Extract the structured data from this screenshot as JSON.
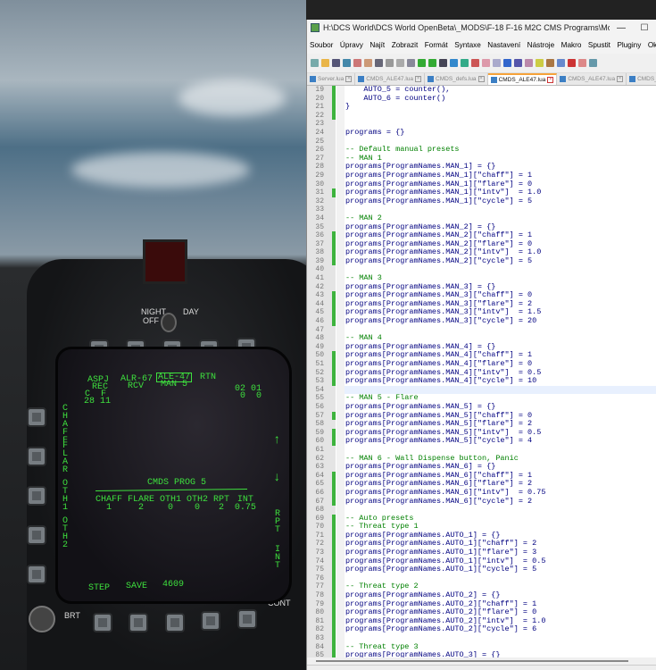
{
  "window": {
    "title": "H:\\DCS World\\DCS World OpenBeta\\_MODS\\F-18 F-16  M2C CMS Programs\\Mods\\aircraft\\FA...",
    "minimize": "—",
    "maximize": "☐"
  },
  "menu": [
    "Soubor",
    "Úpravy",
    "Najít",
    "Zobrazit",
    "Formát",
    "Syntaxe",
    "Nastavení",
    "Nástroje",
    "Makro",
    "Spustit",
    "Pluginy",
    "Okna",
    "?"
  ],
  "tabs": [
    {
      "label": "Server.lua"
    },
    {
      "label": "CMDS_ALE47.lua"
    },
    {
      "label": "CMDS_defs.lua"
    },
    {
      "label": "CMDS_ALE47.lua",
      "active": true
    },
    {
      "label": "CMDS_ALE47.lua"
    },
    {
      "label": "CMDS_defs.lua"
    }
  ],
  "editor": {
    "first_line": 19,
    "current_line": 54,
    "changed_lines": [
      19,
      20,
      21,
      22,
      31,
      36,
      37,
      38,
      39,
      43,
      44,
      45,
      46,
      50,
      51,
      52,
      53,
      57,
      59,
      60,
      64,
      65,
      66,
      67,
      69,
      70,
      71,
      72,
      73,
      74,
      75,
      76,
      77,
      78,
      79,
      80,
      81,
      82,
      83,
      84,
      85
    ],
    "lines": [
      "    AUTO_5 = counter(),",
      "    AUTO_6 = counter()",
      "}",
      "",
      "",
      "programs = {}",
      "",
      "-- Default manual presets",
      "-- MAN 1",
      "programs[ProgramNames.MAN_1] = {}",
      "programs[ProgramNames.MAN_1][\"chaff\"] = 1",
      "programs[ProgramNames.MAN_1][\"flare\"] = 0",
      "programs[ProgramNames.MAN_1][\"intv\"]  = 1.0",
      "programs[ProgramNames.MAN_1][\"cycle\"] = 5",
      "",
      "-- MAN 2",
      "programs[ProgramNames.MAN_2] = {}",
      "programs[ProgramNames.MAN_2][\"chaff\"] = 1",
      "programs[ProgramNames.MAN_2][\"flare\"] = 0",
      "programs[ProgramNames.MAN_2][\"intv\"]  = 1.0",
      "programs[ProgramNames.MAN_2][\"cycle\"] = 5",
      "",
      "-- MAN 3",
      "programs[ProgramNames.MAN_3] = {}",
      "programs[ProgramNames.MAN_3][\"chaff\"] = 0",
      "programs[ProgramNames.MAN_3][\"flare\"] = 2",
      "programs[ProgramNames.MAN_3][\"intv\"]  = 1.5",
      "programs[ProgramNames.MAN_3][\"cycle\"] = 20",
      "",
      "-- MAN 4",
      "programs[ProgramNames.MAN_4] = {}",
      "programs[ProgramNames.MAN_4][\"chaff\"] = 1",
      "programs[ProgramNames.MAN_4][\"flare\"] = 0",
      "programs[ProgramNames.MAN_4][\"intv\"]  = 0.5",
      "programs[ProgramNames.MAN_4][\"cycle\"] = 10",
      "",
      "-- MAN 5 - Flare",
      "programs[ProgramNames.MAN_5] = {}",
      "programs[ProgramNames.MAN_5][\"chaff\"] = 0",
      "programs[ProgramNames.MAN_5][\"flare\"] = 2",
      "programs[ProgramNames.MAN_5][\"intv\"]  = 0.5",
      "programs[ProgramNames.MAN_5][\"cycle\"] = 4",
      "",
      "-- MAN 6 - Wall Dispense button, Panic",
      "programs[ProgramNames.MAN_6] = {}",
      "programs[ProgramNames.MAN_6][\"chaff\"] = 1",
      "programs[ProgramNames.MAN_6][\"flare\"] = 2",
      "programs[ProgramNames.MAN_6][\"intv\"]  = 0.75",
      "programs[ProgramNames.MAN_6][\"cycle\"] = 2",
      "",
      "-- Auto presets",
      "-- Threat type 1",
      "programs[ProgramNames.AUTO_1] = {}",
      "programs[ProgramNames.AUTO_1][\"chaff\"] = 2",
      "programs[ProgramNames.AUTO_1][\"flare\"] = 3",
      "programs[ProgramNames.AUTO_1][\"intv\"]  = 0.5",
      "programs[ProgramNames.AUTO_1][\"cycle\"] = 5",
      "",
      "-- Threat type 2",
      "programs[ProgramNames.AUTO_2] = {}",
      "programs[ProgramNames.AUTO_2][\"chaff\"] = 1",
      "programs[ProgramNames.AUTO_2][\"flare\"] = 0",
      "programs[ProgramNames.AUTO_2][\"intv\"]  = 1.0",
      "programs[ProgramNames.AUTO_2][\"cycle\"] = 6",
      "",
      "-- Threat type 3",
      "programs[ProgramNames.AUTO_3] = {}"
    ]
  },
  "cockpit": {
    "night": "NIGHT",
    "off": "OFF",
    "day": "DAY",
    "brt": "BRT",
    "cont": "CONT"
  },
  "mfd": {
    "aspj": "ASPJ",
    "aspj_sub": "REC",
    "alr": "ALR-67",
    "alr_sub": "RCV",
    "ale": "ALE-47",
    "ale_sub": "MAN 5",
    "rtn": "RTN",
    "cf_labels": "C  F",
    "cf_values": "28 11",
    "o_labels": "02 01",
    "o_values": "0  0",
    "left": [
      "CHAFF",
      "FLAR",
      "OTH1",
      "OTH2"
    ],
    "right_up": "↑",
    "right_down": "↓",
    "rpt": "RPT",
    "int": "INT",
    "prog_title": "CMDS PROG 5",
    "columns": [
      {
        "h": "CHAFF",
        "v": "1"
      },
      {
        "h": "FLARE",
        "v": "2"
      },
      {
        "h": "OTH1",
        "v": "0"
      },
      {
        "h": "OTH2",
        "v": "0"
      },
      {
        "h": "RPT",
        "v": "2"
      },
      {
        "h": "INT",
        "v": "0.75"
      }
    ],
    "step": "STEP",
    "save": "SAVE",
    "code": "4609"
  }
}
